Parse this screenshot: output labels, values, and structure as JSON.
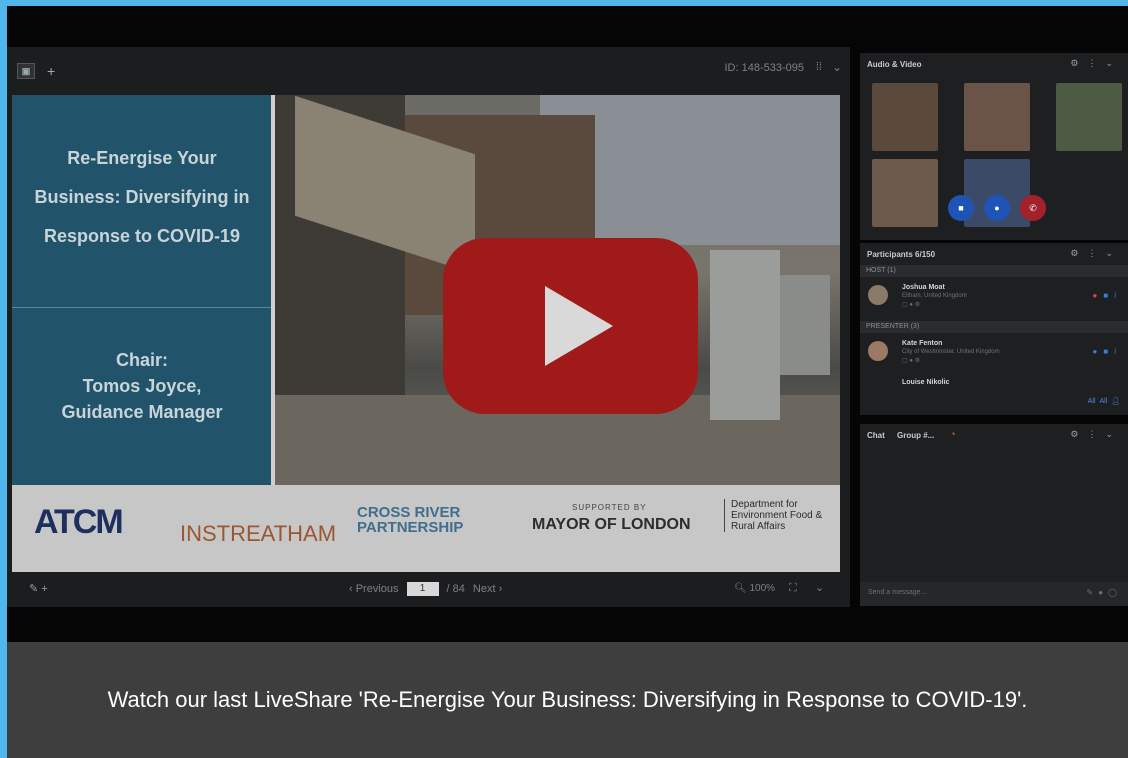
{
  "toolbar": {
    "add_tab": "+",
    "session_id": "ID: 148-533-095"
  },
  "slide": {
    "title": "Re-Energise Your Business: Diversifying in Response to COVID-19",
    "chair_label": "Chair:",
    "chair_name": "Tomos Joyce,",
    "chair_role": "Guidance Manager",
    "logos": {
      "atcm": "ATCM",
      "instreatham": "INSTREATHAM",
      "cross_river": "CROSS RIVER PARTNERSHIP",
      "supported_by": "SUPPORTED BY",
      "mayor": "MAYOR OF LONDON",
      "defra": "Department for Environment Food & Rural Affairs"
    }
  },
  "pager": {
    "previous": "‹ Previous",
    "page": "1",
    "total": "/ 84",
    "next": "Next ›",
    "zoom": "100%"
  },
  "audio_video": {
    "title": "Audio & Video"
  },
  "participants": {
    "title": "Participants 6/150",
    "host_label": "HOST (1)",
    "host": {
      "name": "Joshua Moat",
      "location": "Eltham, United Kingdom"
    },
    "presenter_label": "PRESENTER (3)",
    "presenter": {
      "name": "Kate Fenton",
      "location": "City of Westminster, United Kingdom"
    },
    "next": {
      "name": "Louise Nikolic"
    },
    "all_1": "All",
    "all_2": "All"
  },
  "chat": {
    "tab_chat": "Chat",
    "tab_group": "Group #...",
    "placeholder": "Send a message..."
  },
  "caption": "Watch our last LiveShare 'Re-Energise Your Business: Diversifying in Response to COVID-19'.",
  "colors": {
    "play_button": "#a01a1a",
    "slide_block": "#21546a",
    "caption_bg": "#3e3e3e",
    "border": "#4fb7ec"
  }
}
